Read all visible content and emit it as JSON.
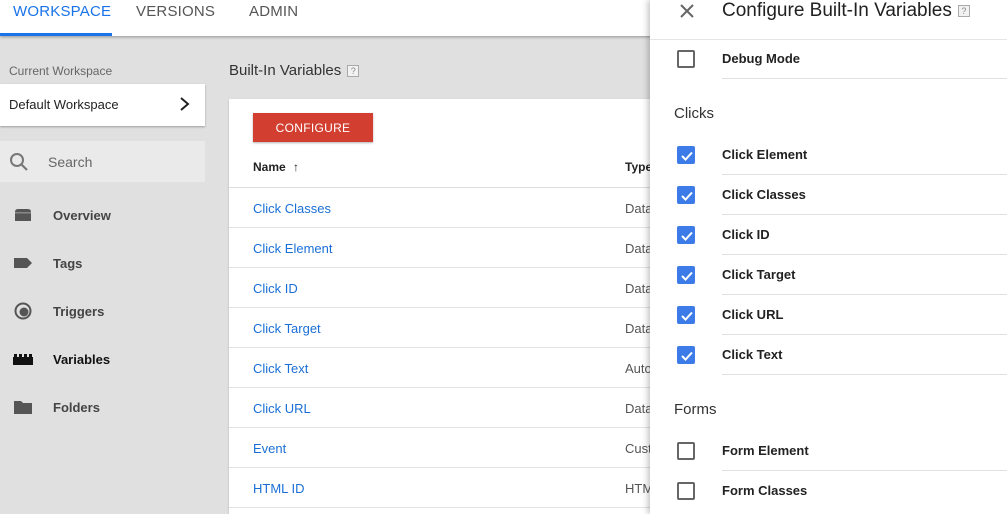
{
  "tabs": [
    {
      "label": "WORKSPACE",
      "active": true
    },
    {
      "label": "VERSIONS",
      "active": false
    },
    {
      "label": "ADMIN",
      "active": false
    }
  ],
  "sidebar": {
    "current_workspace_label": "Current Workspace",
    "workspace_name": "Default Workspace",
    "search_placeholder": "Search",
    "nav": [
      {
        "label": "Overview",
        "icon": "overview-icon",
        "active": false
      },
      {
        "label": "Tags",
        "icon": "tag-icon",
        "active": false
      },
      {
        "label": "Triggers",
        "icon": "trigger-icon",
        "active": false
      },
      {
        "label": "Variables",
        "icon": "variables-icon",
        "active": true
      },
      {
        "label": "Folders",
        "icon": "folder-icon",
        "active": false
      }
    ]
  },
  "main": {
    "title": "Built-In Variables",
    "help": "?",
    "configure_label": "CONFIGURE",
    "columns": {
      "name": "Name",
      "sort_arrow": "↑",
      "type": "Type"
    },
    "rows": [
      {
        "name": "Click Classes",
        "type": "Data"
      },
      {
        "name": "Click Element",
        "type": "Data"
      },
      {
        "name": "Click ID",
        "type": "Data"
      },
      {
        "name": "Click Target",
        "type": "Data"
      },
      {
        "name": "Click Text",
        "type": "Auto"
      },
      {
        "name": "Click URL",
        "type": "Data"
      },
      {
        "name": "Event",
        "type": "Cust"
      },
      {
        "name": "HTML ID",
        "type": "HTM"
      }
    ]
  },
  "panel": {
    "title": "Configure Built-In Variables",
    "help": "?",
    "top_items": [
      {
        "label": "Debug Mode",
        "checked": false
      }
    ],
    "sections": [
      {
        "title": "Clicks",
        "items": [
          {
            "label": "Click Element",
            "checked": true
          },
          {
            "label": "Click Classes",
            "checked": true
          },
          {
            "label": "Click ID",
            "checked": true
          },
          {
            "label": "Click Target",
            "checked": true
          },
          {
            "label": "Click URL",
            "checked": true
          },
          {
            "label": "Click Text",
            "checked": true
          }
        ]
      },
      {
        "title": "Forms",
        "items": [
          {
            "label": "Form Element",
            "checked": false
          },
          {
            "label": "Form Classes",
            "checked": false
          }
        ]
      }
    ]
  },
  "colors": {
    "accent": "#1a73e8",
    "configure": "#d23f31",
    "checkbox": "#3d7ce8",
    "link": "#1a6fd6"
  }
}
